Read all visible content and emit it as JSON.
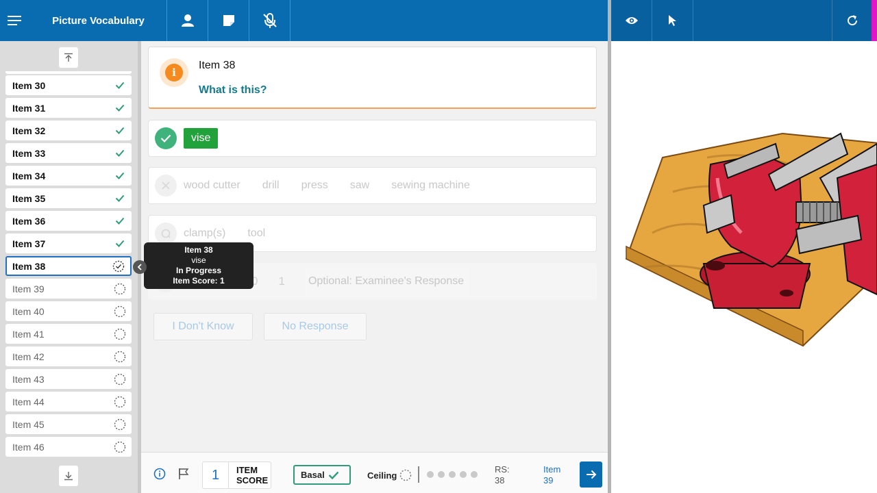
{
  "header": {
    "title": "Picture Vocabulary",
    "icons": [
      "menu-icon",
      "examinee-icon",
      "notes-icon",
      "mic-off-icon"
    ],
    "right_icons": [
      "eye-icon",
      "pointer-icon",
      "refresh-icon"
    ]
  },
  "sidebar": {
    "items": [
      {
        "label": "Item 30",
        "status": "complete"
      },
      {
        "label": "Item 31",
        "status": "complete"
      },
      {
        "label": "Item 32",
        "status": "complete"
      },
      {
        "label": "Item 33",
        "status": "complete"
      },
      {
        "label": "Item 34",
        "status": "complete"
      },
      {
        "label": "Item 35",
        "status": "complete"
      },
      {
        "label": "Item 36",
        "status": "complete"
      },
      {
        "label": "Item 37",
        "status": "complete"
      },
      {
        "label": "Item 38",
        "status": "in-progress"
      },
      {
        "label": "Item 39",
        "status": "not-started"
      },
      {
        "label": "Item 40",
        "status": "not-started"
      },
      {
        "label": "Item 41",
        "status": "not-started"
      },
      {
        "label": "Item 42",
        "status": "not-started"
      },
      {
        "label": "Item 43",
        "status": "not-started"
      },
      {
        "label": "Item 44",
        "status": "not-started"
      },
      {
        "label": "Item 45",
        "status": "not-started"
      },
      {
        "label": "Item 46",
        "status": "not-started"
      }
    ]
  },
  "tooltip": {
    "item": "Item 38",
    "answer": "vise",
    "status": "In Progress",
    "score": "Item Score: 1"
  },
  "question": {
    "item": "Item 38",
    "prompt": "What is this?"
  },
  "correct": {
    "answer": "vise"
  },
  "incorrect_options": [
    "wood cutter",
    "drill",
    "press",
    "saw",
    "sewing machine"
  ],
  "query_options": [
    "clamp(s)",
    "tool"
  ],
  "scoring": {
    "zero": "0",
    "one": "1",
    "response_placeholder": "Optional: Examinee's Response"
  },
  "buttons": {
    "dont_know": "I Don't Know",
    "no_response": "No Response"
  },
  "footer": {
    "item_score_value": "1",
    "item_score_line1": "ITEM",
    "item_score_line2": "SCORE",
    "basal": "Basal",
    "ceiling": "Ceiling",
    "rs_label": "RS:",
    "rs_value": "38",
    "next_label": "Item",
    "next_value": "39"
  },
  "colors": {
    "header_blue": "#0a6cb0",
    "correct_green": "#22a23a",
    "check_green": "#2e9c7a",
    "info_orange": "#f58b1f",
    "question_teal": "#147a8c"
  },
  "image": {
    "subject": "red bench vise on wooden board"
  }
}
